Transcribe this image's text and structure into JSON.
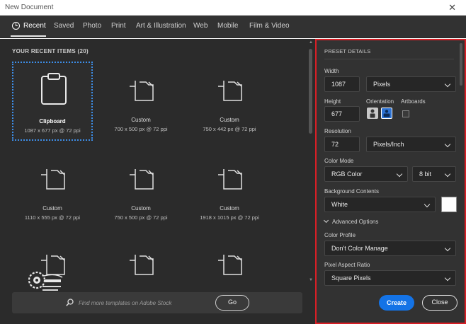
{
  "window": {
    "title": "New Document",
    "close_glyph": "✕"
  },
  "tabs": [
    {
      "label": "Recent",
      "icon": "clock-icon"
    },
    {
      "label": "Saved"
    },
    {
      "label": "Photo"
    },
    {
      "label": "Print"
    },
    {
      "label": "Art & Illustration"
    },
    {
      "label": "Web"
    },
    {
      "label": "Mobile"
    },
    {
      "label": "Film & Video"
    }
  ],
  "recent": {
    "heading": "YOUR RECENT ITEMS  (20)",
    "items": [
      {
        "name": "Clipboard",
        "size": "1087 x 677 px @ 72 ppi",
        "icon": "clipboard-icon",
        "selected": true
      },
      {
        "name": "Custom",
        "size": "700 x 500 px @ 72 ppi",
        "icon": "document-icon"
      },
      {
        "name": "Custom",
        "size": "750 x 442 px @ 72 ppi",
        "icon": "document-icon"
      },
      {
        "name": "Custom",
        "size": "1110 x 555 px @ 72 ppi",
        "icon": "document-icon"
      },
      {
        "name": "Custom",
        "size": "750 x 500 px @ 72 ppi",
        "icon": "document-icon"
      },
      {
        "name": "Custom",
        "size": "1918 x 1015 px @ 72 ppi",
        "icon": "document-icon"
      },
      {
        "name": "",
        "size": "",
        "icon": "document-icon"
      },
      {
        "name": "",
        "size": "",
        "icon": "document-icon"
      },
      {
        "name": "",
        "size": "",
        "icon": "document-icon"
      }
    ]
  },
  "search": {
    "placeholder": "Find more templates on Adobe Stock",
    "go_label": "Go"
  },
  "preset": {
    "heading": "PRESET DETAILS",
    "width_label": "Width",
    "width_value": "1087",
    "width_unit": "Pixels",
    "height_label": "Height",
    "height_value": "677",
    "orientation_label": "Orientation",
    "artboards_label": "Artboards",
    "resolution_label": "Resolution",
    "resolution_value": "72",
    "resolution_unit": "Pixels/Inch",
    "color_mode_label": "Color Mode",
    "color_mode": "RGB Color",
    "bit_depth": "8 bit",
    "background_label": "Background Contents",
    "background": "White",
    "background_color": "#ffffff",
    "advanced_label": "Advanced Options",
    "color_profile_label": "Color Profile",
    "color_profile": "Don't Color Manage",
    "pixel_aspect_label": "Pixel Aspect Ratio",
    "pixel_aspect": "Square Pixels",
    "create_label": "Create",
    "close_label": "Close"
  },
  "colors": {
    "accent": "#1473e6",
    "highlight_border": "#d81f26",
    "selection": "#3d8ee8"
  }
}
